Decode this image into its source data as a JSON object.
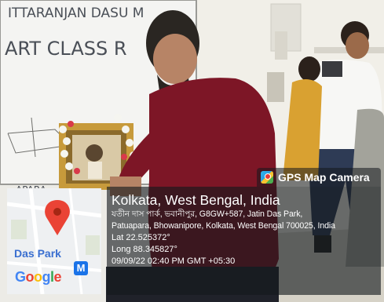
{
  "board": {
    "line1": "ITTARANJAN DASU M",
    "line2": "ART   CLASS  R",
    "side_text": "APARA"
  },
  "gps_badge": {
    "title": "GPS Map Camera",
    "icon": "gps-map-camera-icon"
  },
  "location": {
    "title": "Kolkata, West Bengal, India",
    "address_line1": "যতীন দাস পার্ক, ভবানীপুর, G8GW+587, Jatin Das Park,",
    "address_line2": "Patuapara, Bhowanipore, Kolkata, West Bengal 700025, India",
    "lat": "Lat 22.525372°",
    "long": "Long 88.345827°",
    "timestamp": "09/09/22 02:40 PM GMT +05:30"
  },
  "map": {
    "place_label": "Das Park",
    "badge": "M",
    "logo": {
      "G": "G",
      "o1": "o",
      "o2": "o",
      "g": "g",
      "l": "l",
      "e": "e"
    },
    "pin_icon": "map-pin-icon"
  },
  "colors": {
    "panel_bg": "#14181c",
    "pin_red": "#ea4335",
    "wall": "#ecebe6",
    "shirt": "#7d1626"
  }
}
